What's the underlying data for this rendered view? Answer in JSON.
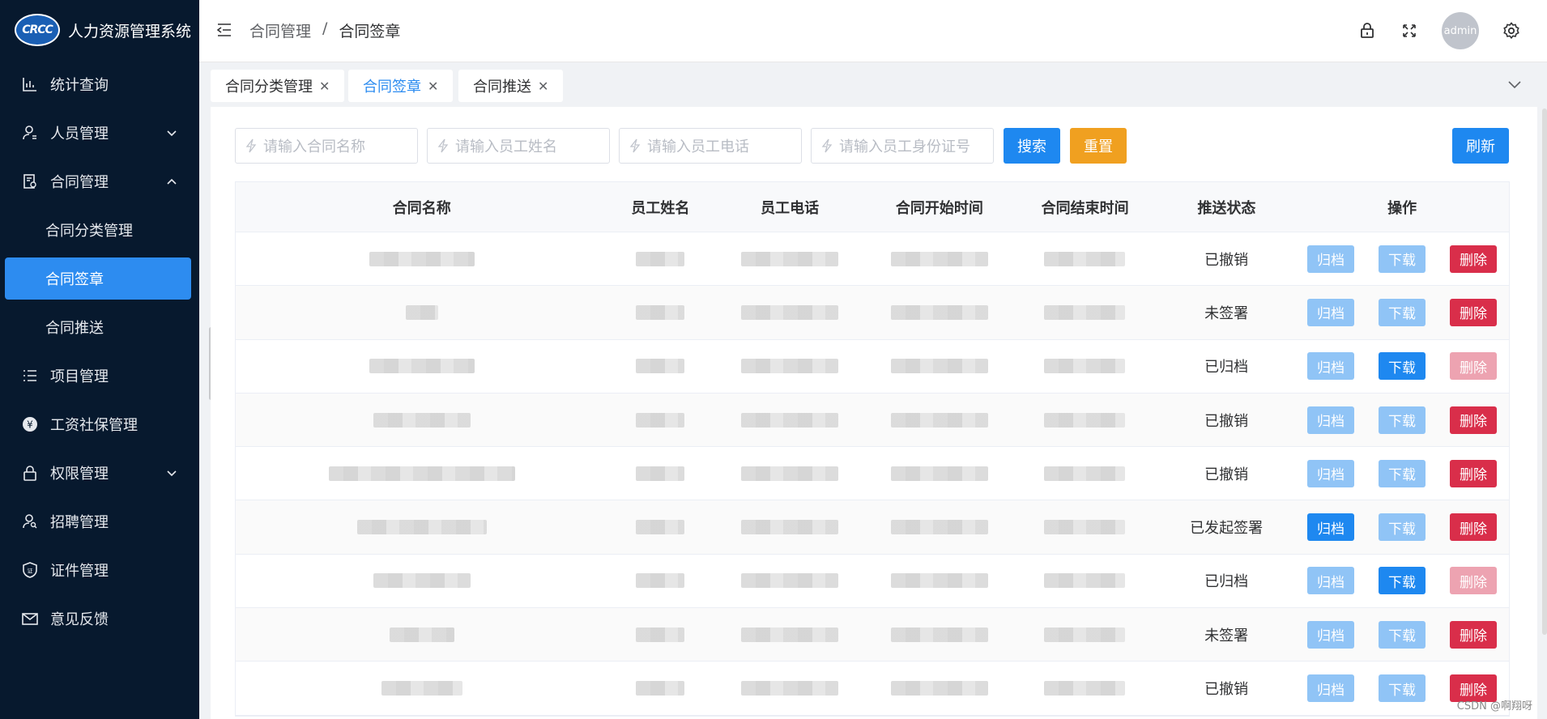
{
  "app": {
    "title": "人力资源管理系统",
    "logo_text": "CRCC"
  },
  "sidebar": {
    "items": [
      {
        "label": "统计查询"
      },
      {
        "label": "人员管理"
      },
      {
        "label": "合同管理"
      },
      {
        "label": "合同分类管理"
      },
      {
        "label": "合同签章"
      },
      {
        "label": "合同推送"
      },
      {
        "label": "项目管理"
      },
      {
        "label": "工资社保管理"
      },
      {
        "label": "权限管理"
      },
      {
        "label": "招聘管理"
      },
      {
        "label": "证件管理"
      },
      {
        "label": "意见反馈"
      }
    ]
  },
  "header": {
    "breadcrumb": [
      "合同管理",
      "/",
      "合同签章"
    ],
    "avatar_text": "admin"
  },
  "tabs": [
    {
      "label": "合同分类管理"
    },
    {
      "label": "合同签章"
    },
    {
      "label": "合同推送"
    }
  ],
  "search": {
    "contract_name_placeholder": "请输入合同名称",
    "employee_name_placeholder": "请输入员工姓名",
    "employee_phone_placeholder": "请输入员工电话",
    "employee_id_placeholder": "请输入员工身份证号",
    "search_label": "搜索",
    "reset_label": "重置",
    "refresh_label": "刷新"
  },
  "table": {
    "columns": [
      "合同名称",
      "员工姓名",
      "员工电话",
      "合同开始时间",
      "合同结束时间",
      "推送状态",
      "操作"
    ],
    "actions": {
      "archive": "归档",
      "download": "下载",
      "delete": "删除"
    },
    "rows": [
      {
        "status": "已撤销"
      },
      {
        "status": "未签署"
      },
      {
        "status": "已归档"
      },
      {
        "status": "已撤销"
      },
      {
        "status": "已撤销"
      },
      {
        "status": "已发起签署"
      },
      {
        "status": "已归档"
      },
      {
        "status": "未签署"
      },
      {
        "status": "已撤销"
      }
    ]
  },
  "watermark": "CSDN @啊翔呀",
  "colors": {
    "sidebar_bg": "#07192e",
    "accent": "#1e88f0",
    "danger": "#d92e4a",
    "warning": "#f0a020"
  }
}
